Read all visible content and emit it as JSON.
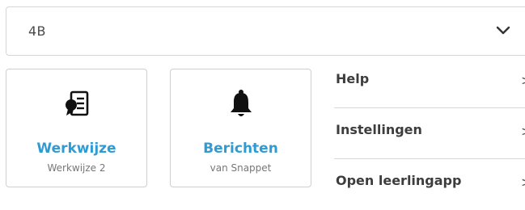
{
  "group_select": {
    "value": "4B"
  },
  "tiles": [
    {
      "title": "Werkwijze",
      "subtitle": "Werkwijze 2",
      "icon": "certificate-document-icon"
    },
    {
      "title": "Berichten",
      "subtitle": "van Snappet",
      "icon": "bell-icon"
    }
  ],
  "menu": [
    {
      "label": "Help"
    },
    {
      "label": "Instellingen"
    },
    {
      "label": "Open leerlingapp"
    }
  ],
  "colors": {
    "accent": "#2f9bd3",
    "border": "#cfcfcf",
    "text": "#3d3d3d"
  }
}
